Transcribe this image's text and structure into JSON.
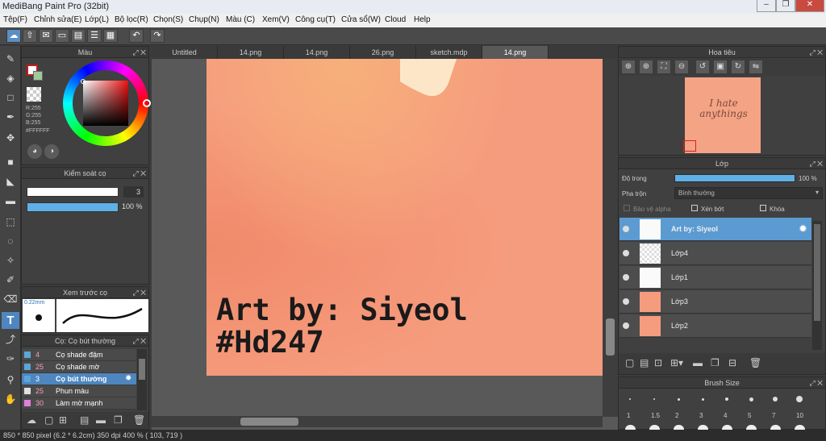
{
  "window": {
    "title": "MediBang Paint Pro (32bit)",
    "controls": [
      "–",
      "❐",
      "✕"
    ]
  },
  "menu": [
    "Tệp(F)",
    "Chỉnh sửa(E)",
    "Lớp(L)",
    "Bộ lọc(R)",
    "Chọn(S)",
    "Chụp(N)",
    "Màu (C)",
    "Xem(V)",
    "Công cụ(T)",
    "Cửa sổ(W)",
    "Cloud",
    "Help"
  ],
  "color_panel": {
    "title": "Màu",
    "r": "R:255",
    "g": "G:255",
    "b": "B:255",
    "hex": "#FFFFFF"
  },
  "brush_control": {
    "title": "Kiểm soát cọ",
    "size": "3",
    "opacity": "100 %",
    "size_fraction": 1.0,
    "opacity_fraction": 1.0
  },
  "brush_preview": {
    "title": "Xem trước cọ",
    "size": "0.22mm"
  },
  "brush_list": {
    "title": "Cọ: Cọ bút thường",
    "items": [
      {
        "size": "4",
        "name": "Cọ shade đậm",
        "color": "#5aa7d6"
      },
      {
        "size": "25",
        "name": "Cọ shade mờ",
        "color": "#5aa7d6"
      },
      {
        "size": "3",
        "name": "Cọ bút thường",
        "color": "#5aa7d6",
        "selected": true
      },
      {
        "size": "25",
        "name": "Phun màu",
        "color": "#e0e0e0"
      },
      {
        "size": "30",
        "name": "Làm mờ mạnh",
        "color": "#e080d8"
      }
    ]
  },
  "tabs": [
    "Untitled",
    "14.png",
    "14.png",
    "26.png",
    "sketch.mdp",
    "14.png"
  ],
  "active_tab_index": 5,
  "canvas": {
    "line1": "Art by: Siyeol",
    "line2": "#Hd247",
    "bg_color": "#f69c7e"
  },
  "navigator": {
    "title": "Hoa tiêu",
    "thumb_text": "I hate anythings"
  },
  "layers_panel": {
    "title": "Lớp",
    "opacity_label": "Độ trong",
    "opacity_value": "100 %",
    "blend_label": "Pha trộn",
    "blend_value": "Bình thường",
    "protect_alpha": "Bảo vệ alpha",
    "clipping": "Xén bớt",
    "lock": "Khóa",
    "layers": [
      {
        "name": "Art by: Siyeol",
        "selected": true
      },
      {
        "name": "Lớp4"
      },
      {
        "name": "Lớp1"
      },
      {
        "name": "Lớp3"
      },
      {
        "name": "Lớp2"
      }
    ]
  },
  "brush_size": {
    "title": "Brush Size",
    "labels": [
      "1",
      "1.5",
      "2",
      "3",
      "4",
      "5",
      "7",
      "10"
    ]
  },
  "status": {
    "text": "850 * 850 pixel    (6.2 * 6.2cm)   350 dpi   400 %   ( 103, 719 )"
  }
}
